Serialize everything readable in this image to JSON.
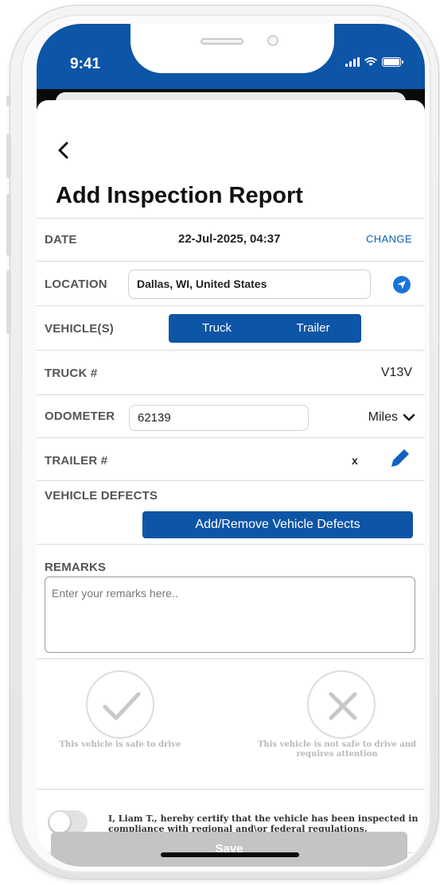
{
  "status_bar": {
    "time": "9:41",
    "bg_color": "#0d55a6"
  },
  "header": {
    "back_icon": "chevron-left-icon",
    "title": "Add Inspection Report"
  },
  "date_row": {
    "label": "DATE",
    "value": "22-Jul-2025, 04:37",
    "action": "CHANGE"
  },
  "location_row": {
    "label": "LOCATION",
    "value": "Dallas, WI, United States",
    "icon": "location-arrow-icon"
  },
  "vehicles_row": {
    "label": "VEHICLE(S)",
    "options": [
      "Truck",
      "Trailer"
    ]
  },
  "truck_row": {
    "label": "TRUCK #",
    "value": "V13V"
  },
  "odometer_row": {
    "label": "ODOMETER",
    "value": "62139",
    "unit": "Miles"
  },
  "trailer_row": {
    "label": "TRAILER #",
    "value": "x",
    "icon": "pencil-icon"
  },
  "defects_row": {
    "label": "VEHICLE DEFECTS",
    "button": "Add/Remove Vehicle Defects"
  },
  "remarks_row": {
    "label": "REMARKS",
    "placeholder": "Enter your remarks here.."
  },
  "safety": {
    "safe_caption": "This vehicle is safe to drive",
    "unsafe_caption_line1": "This vehicle is not safe to drive and",
    "unsafe_caption_line2": "requires attention"
  },
  "certification": {
    "toggle_on": false,
    "text": "I, Liam T., hereby certify that the vehicle has been inspected in compliance with regional and\\or federal regulations."
  },
  "footer": {
    "save_label": "Save"
  },
  "colors": {
    "primary": "#0d55a6",
    "link": "#1060b0",
    "disabled": "#c4c4c4"
  }
}
